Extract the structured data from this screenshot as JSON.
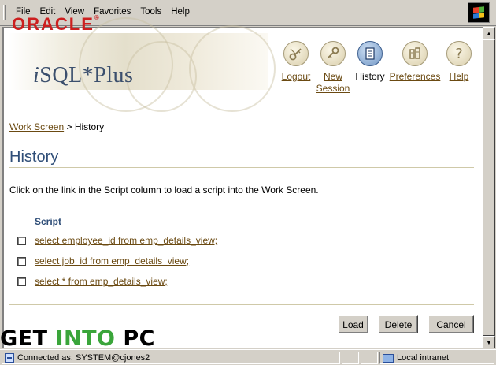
{
  "menubar": {
    "items": [
      {
        "label": "File"
      },
      {
        "label": "Edit"
      },
      {
        "label": "View"
      },
      {
        "label": "Favorites"
      },
      {
        "label": "Tools"
      },
      {
        "label": "Help"
      }
    ]
  },
  "header": {
    "oracle_logo": "ORACLE",
    "product_logo_prefix": "i",
    "product_logo_rest": "SQL*Plus"
  },
  "nav": {
    "logout": {
      "label": "Logout",
      "icon": "key-logout-icon"
    },
    "new_session": {
      "label_line1": "New",
      "label_line2": "Session",
      "icon": "key-icon"
    },
    "history": {
      "label": "History",
      "icon": "history-icon"
    },
    "preferences": {
      "label": "Preferences",
      "icon": "preferences-icon"
    },
    "help": {
      "label": "Help",
      "icon": "question-mark-icon"
    }
  },
  "breadcrumb": {
    "link": "Work Screen",
    "separator": ">",
    "current": "History"
  },
  "page": {
    "title": "History",
    "instruction": "Click on the link in the Script column to load a script into the Work Screen."
  },
  "script_table": {
    "column_header": "Script",
    "rows": [
      {
        "script": "select employee_id from emp_details_view;",
        "checked": false
      },
      {
        "script": "select job_id from emp_details_view;",
        "checked": false
      },
      {
        "script": "select * from emp_details_view;",
        "checked": false
      }
    ]
  },
  "buttons": {
    "load": "Load",
    "delete": "Delete",
    "cancel": "Cancel"
  },
  "watermark": {
    "part1": "GET ",
    "part2": "INTO",
    "part3": " PC"
  },
  "statusbar": {
    "connection": "Connected as: SYSTEM@cjones2",
    "zone": "Local intranet"
  },
  "colors": {
    "oracle_red": "#cc1f1f",
    "title_blue": "#2f4e78",
    "link_brown": "#6b4a12",
    "watermark_green": "#3aa53a"
  }
}
